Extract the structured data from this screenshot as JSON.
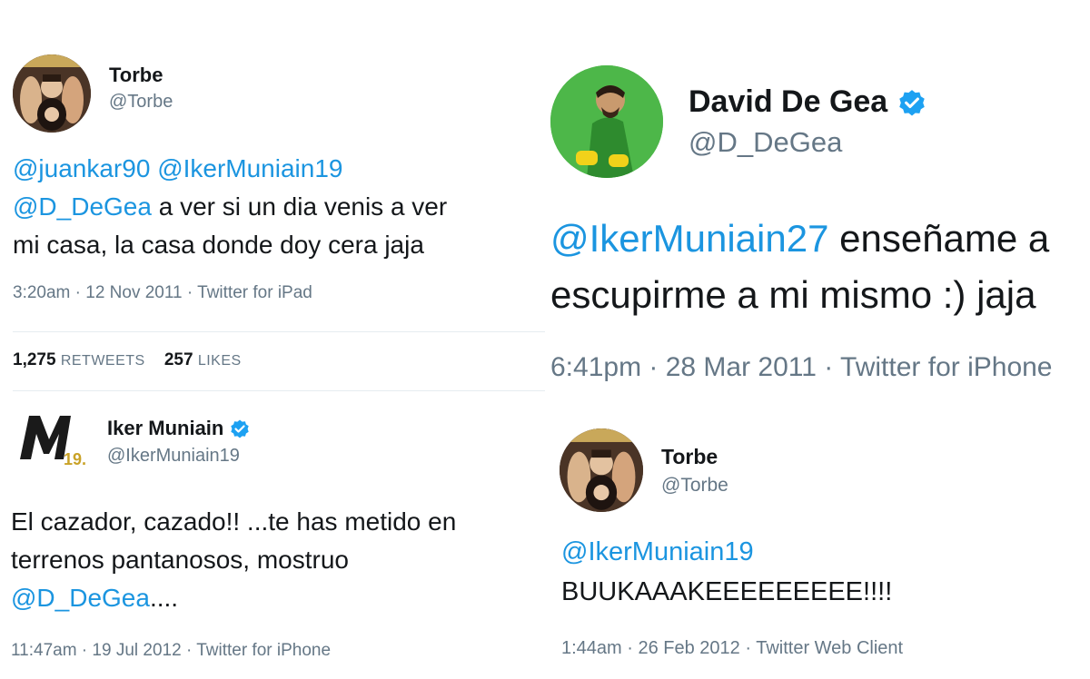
{
  "tweet1": {
    "name": "Torbe",
    "handle": "@Torbe",
    "mention1": "@juankar90",
    "mention2": "@IkerMuniain19",
    "mention3": "@D_DeGea",
    "text_a": " a ver si un dia venis a ver",
    "text_b": "mi casa, la casa donde doy cera jaja",
    "meta": "3:20am · 12 Nov 2011 · Twitter for iPad",
    "retweets_count": "1,275",
    "retweets_label": "RETWEETS",
    "likes_count": "257",
    "likes_label": "LIKES"
  },
  "tweet2": {
    "name": "Iker Muniain",
    "handle": "@IkerMuniain19",
    "text_a": "El cazador, cazado!! ...te has metido en",
    "text_b": "terrenos pantanosos, mostruo",
    "mention1": "@D_DeGea",
    "text_c": "....",
    "meta": "11:47am · 19 Jul 2012 · Twitter for iPhone"
  },
  "tweet3": {
    "name": "David De Gea",
    "handle": "@D_DeGea",
    "mention1": "@IkerMuniain27",
    "text_a": " enseñame a",
    "text_b": "escupirme a mi mismo :) jaja",
    "meta": "6:41pm · 28 Mar 2011 · Twitter for iPhone"
  },
  "tweet4": {
    "name": "Torbe",
    "handle": "@Torbe",
    "mention1": "@IkerMuniain19",
    "text_a": "BUUKAAAKEEEEEEEEE!!!!",
    "meta": "1:44am · 26 Feb 2012 · Twitter Web Client"
  },
  "icons": [
    "verified-badge-icon"
  ],
  "colors": {
    "link": "#1b95e0",
    "secondary": "#657786",
    "verified": "#1da1f2"
  }
}
